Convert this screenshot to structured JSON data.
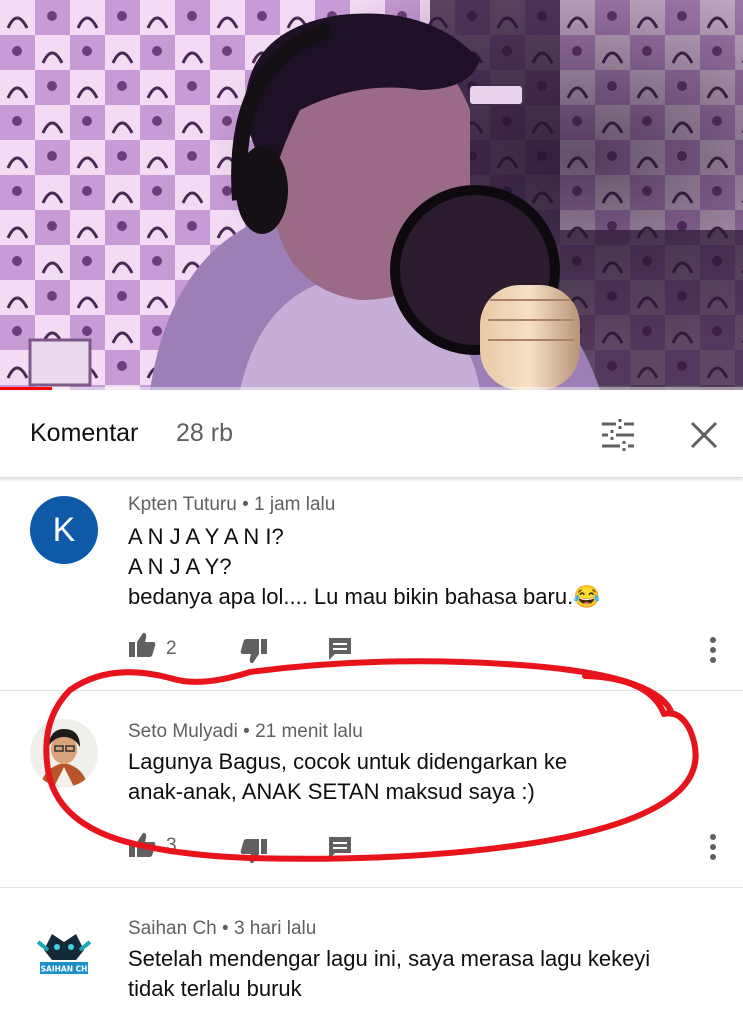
{
  "video": {
    "progress_fraction": 0.07,
    "progress_color": "#ff0000"
  },
  "header": {
    "title": "Komentar",
    "count": "28 rb",
    "filter_icon": "sort-filter-icon",
    "close_icon": "close-icon"
  },
  "comments": [
    {
      "author": "Kpten Tuturu",
      "time": "1 jam lalu",
      "avatar_letter": "K",
      "avatar_color": "#0f5aa8",
      "lines": [
        "A N J A Y A N I?",
        "A N J A Y?",
        "bedanya apa lol.... Lu mau bikin bahasa baru.😂"
      ],
      "likes": "2"
    },
    {
      "author": "Seto Mulyadi",
      "time": "21 menit lalu",
      "lines": [
        "Lagunya Bagus, cocok untuk didengarkan ke",
        "anak-anak, ANAK SETAN maksud saya :)"
      ],
      "likes": "3"
    },
    {
      "author": "Saihan Ch",
      "time": "3 hari lalu",
      "avatar_text": "SAIHAN CH",
      "lines": [
        "Setelah mendengar lagu ini, saya merasa lagu kekeyi",
        "tidak terlalu buruk"
      ]
    }
  ],
  "separator": " • ",
  "annotation_color": "#e8141c"
}
